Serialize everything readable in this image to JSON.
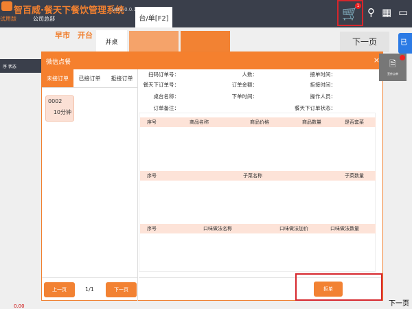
{
  "app": {
    "title": "智百威·餐天下餐饮管理系统",
    "version": "Ver1.0.0.1",
    "trial": "试用版",
    "company": "公司总部",
    "tab": "台/单[F2]",
    "cart_badge": "1"
  },
  "toolbar_icons": [
    "cart-icon",
    "search-icon",
    "grid-icon",
    "window-icon"
  ],
  "sub": {
    "market": "早市",
    "open": "开台",
    "merge": "并桌",
    "next_page": "下一页",
    "blue_btn": "已"
  },
  "strip": {
    "label": "序  状态"
  },
  "dialog": {
    "title": "微信点餐",
    "close": "×",
    "tabs": [
      "未接订单",
      "已接订单",
      "拒接订单"
    ],
    "order_card": {
      "id": "0002",
      "elapsed": "10分钟"
    },
    "pager": {
      "prev": "上一页",
      "page": "1/1",
      "next": "下一页"
    },
    "fields": {
      "col1": [
        "扫码订单号：",
        "餐天下订单号：",
        "桌台名称：",
        "订单备注："
      ],
      "col2": [
        "人数：",
        "订单金额：",
        "下单时间："
      ],
      "col3": [
        "接单时间：",
        "拒接时间：",
        "操作人员：",
        "餐天下订单状态："
      ]
    },
    "table1": [
      "序号",
      "商品名称",
      "商品价格",
      "商品数量",
      "是否套菜"
    ],
    "table2": [
      "序号",
      "子菜名称",
      "子菜数量"
    ],
    "table3": [
      "序号",
      "口味做法名称",
      "口味做法加价",
      "口味做法数量"
    ],
    "reject": "拒单"
  },
  "side_widget": {
    "label": "宣传点单"
  },
  "bottom": {
    "next": "下一页",
    "value": "0.00"
  },
  "colors": {
    "accent": "#f5802e",
    "topbar": "#3a3f4b",
    "header_row": "#fde3d8",
    "highlight": "#d6262c"
  }
}
